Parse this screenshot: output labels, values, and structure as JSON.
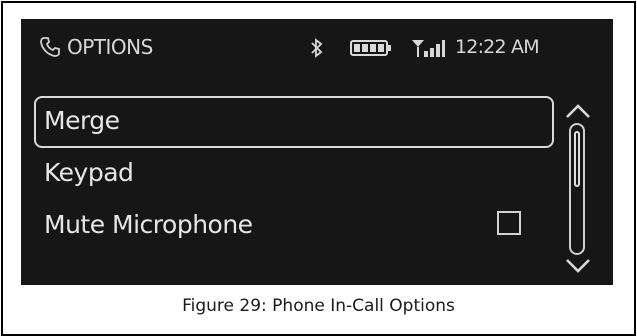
{
  "screen": {
    "title": "OPTIONS",
    "clock": "12:22 AM",
    "icons": [
      "phone-icon",
      "bluetooth-icon",
      "battery-icon",
      "signal-icon"
    ],
    "menu": {
      "items": [
        {
          "label": "Merge",
          "selected": true
        },
        {
          "label": "Keypad",
          "selected": false
        },
        {
          "label": "Mute Microphone",
          "selected": false,
          "checkbox": "unchecked"
        }
      ]
    },
    "scrollbar": {
      "up_icon": "chevron-up-icon",
      "down_icon": "chevron-down-icon"
    }
  },
  "caption": "Figure 29: Phone In-Call Options",
  "colors": {
    "screen_bg": "#161616",
    "text": "#e6e6e6",
    "frame": "#000000"
  }
}
